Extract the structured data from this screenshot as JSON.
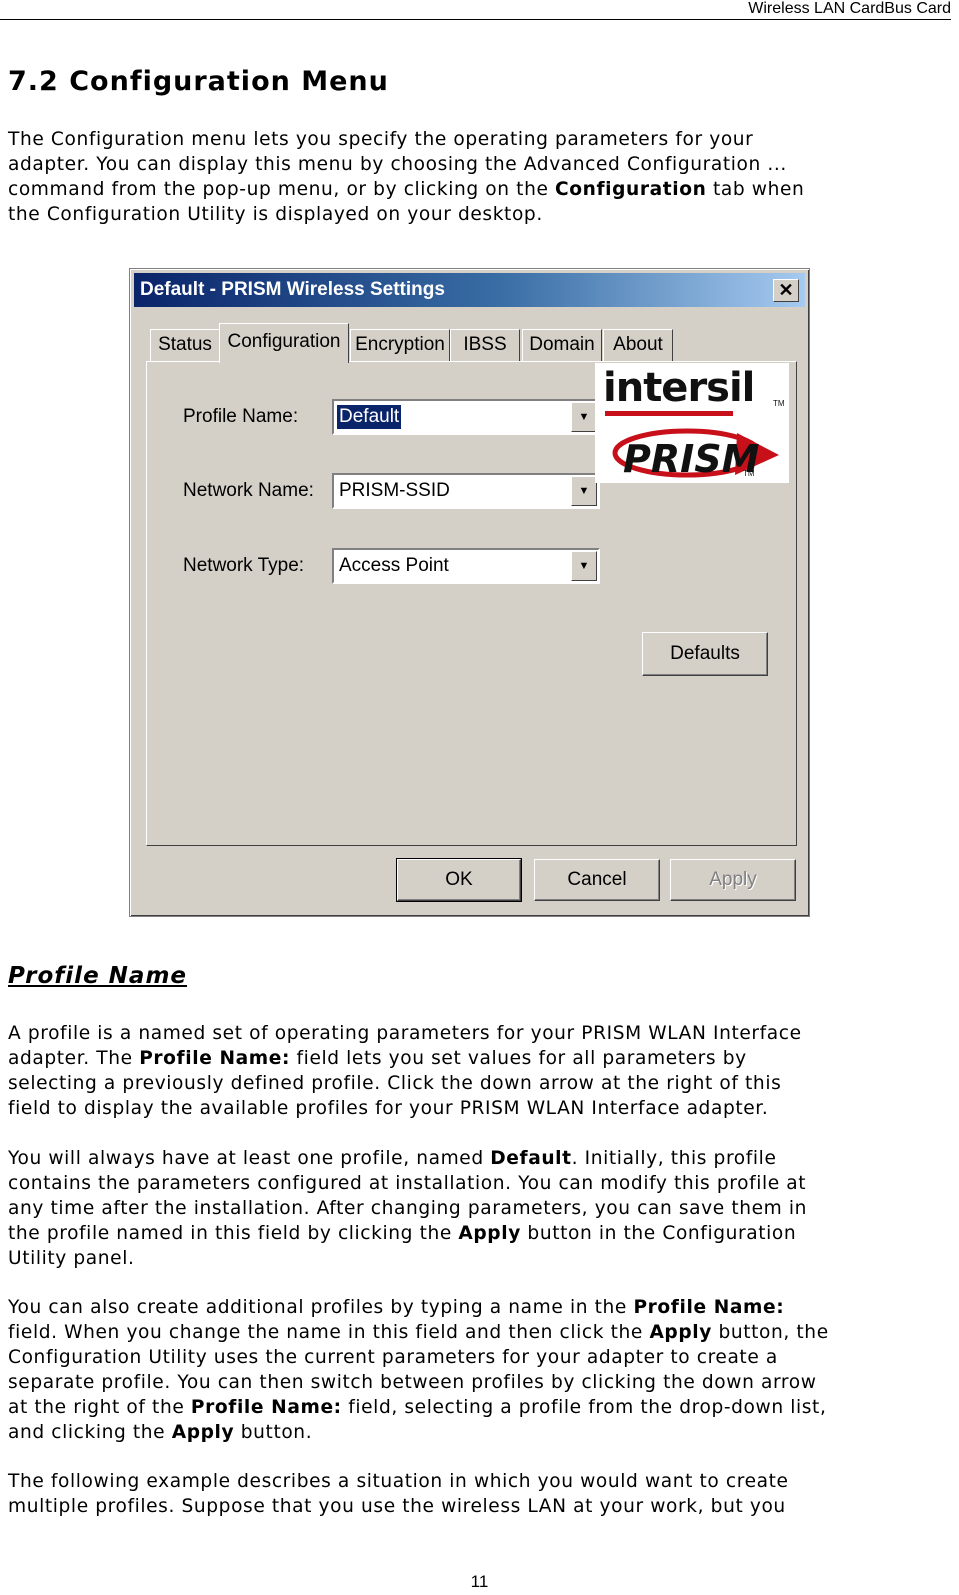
{
  "header": {
    "running_title": "Wireless LAN CardBus Card"
  },
  "section": {
    "heading": "7.2 Configuration Menu",
    "intro": {
      "part1": "The Configuration menu lets you specify the operating parameters for your\nadapter. You can display this menu by choosing the Advanced Configuration ...\ncommand from the pop-up menu, or by clicking on the ",
      "bold1": "Configuration",
      "part2": " tab when\nthe Configuration Utility is displayed on your desktop."
    }
  },
  "dialog": {
    "title": "Default - PRISM Wireless Settings",
    "close_glyph": "✕",
    "tabs": [
      {
        "label": "Status"
      },
      {
        "label": "Configuration",
        "active": true
      },
      {
        "label": "Encryption"
      },
      {
        "label": "IBSS"
      },
      {
        "label": "Domain"
      },
      {
        "label": "About"
      }
    ],
    "fields": {
      "profile_name": {
        "label": "Profile Name:",
        "value": "Default"
      },
      "network_name": {
        "label": "Network Name:",
        "value": "PRISM-SSID"
      },
      "network_type": {
        "label": "Network Type:",
        "value": "Access Point"
      }
    },
    "logo": {
      "brand": "intersil",
      "product": "PRISM",
      "tm": "TM"
    },
    "buttons": {
      "defaults": "Defaults",
      "ok": "OK",
      "cancel": "Cancel",
      "apply": "Apply"
    }
  },
  "profile_name_section": {
    "heading": "Profile Name",
    "p1": {
      "a": "A profile is a named set of operating parameters for your PRISM WLAN Interface\nadapter. The ",
      "b": "Profile Name:",
      "c": " field lets you set values for all parameters by\nselecting a previously defined profile. Click the down arrow at the right of this\nfield to display the available profiles for your PRISM WLAN Interface adapter."
    },
    "p2": {
      "a": "You will always have at least one profile, named ",
      "b": "Default",
      "c": ". Initially, this profile\ncontains the parameters configured at installation. You can modify this profile at\nany time after the installation. After changing parameters, you can save them in\nthe profile named in this field by clicking the ",
      "d": "Apply",
      "e": " button in the Configuration\nUtility panel."
    },
    "p3": {
      "a": "You can also create additional profiles by typing a name in the ",
      "b": "Profile Name:",
      "c": "\nfield. When you change the name in this field and then click the ",
      "d": "Apply",
      "e": " button, the\nConfiguration Utility uses the current parameters for your adapter to create a\nseparate profile. You can then switch between profiles by clicking the down arrow\nat the right of the ",
      "f": "Profile Name:",
      "g": " field, selecting a profile from the drop-down list,\nand clicking the ",
      "h": "Apply",
      "i": " button."
    },
    "p4": "The following example describes a situation in which you would want to create\nmultiple profiles. Suppose that you use the wireless LAN at your work, but you"
  },
  "footer": {
    "page_number": "11"
  }
}
